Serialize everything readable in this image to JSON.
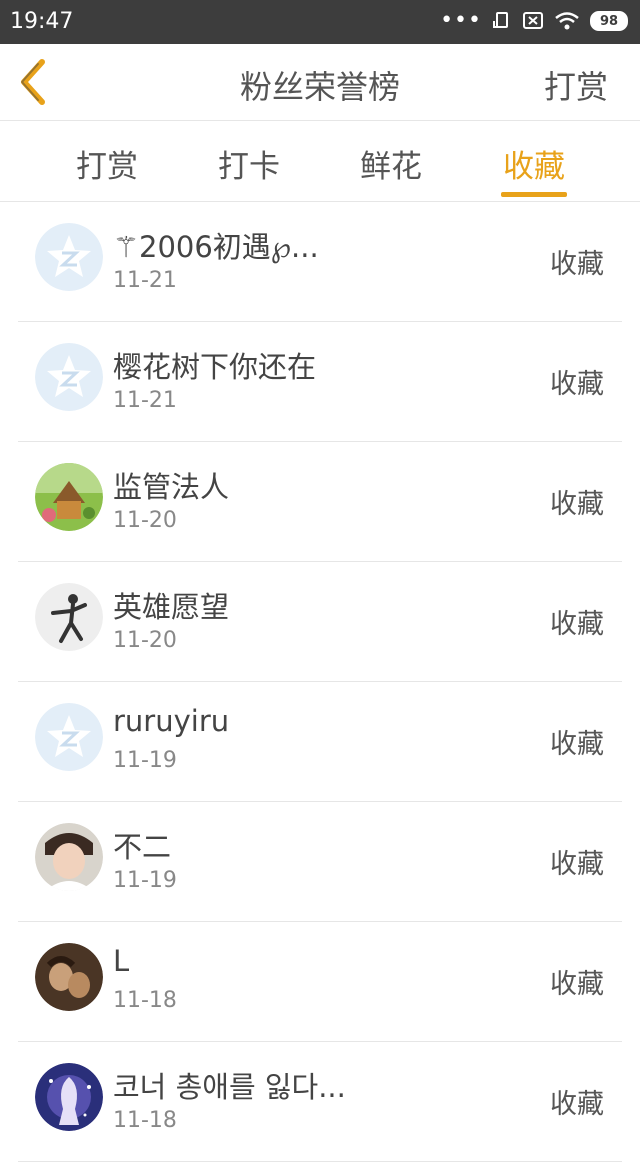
{
  "status_bar": {
    "time": "19:47",
    "battery": "98",
    "dots": "•••"
  },
  "header": {
    "title": "粉丝荣誉榜",
    "action": "打赏"
  },
  "tabs": [
    {
      "label": "打赏"
    },
    {
      "label": "打卡"
    },
    {
      "label": "鲜花"
    },
    {
      "label": "收藏"
    }
  ],
  "active_tab": "收藏",
  "colors": {
    "accent": "#e8a21a",
    "status_bar": "#3d3d3d",
    "text": "#555555",
    "divider": "#e6e6e6"
  },
  "list": [
    {
      "name": "⚚2006初遇℘...",
      "date": "11-21",
      "action": "收藏",
      "avatar": "default-qq-avatar"
    },
    {
      "name": "樱花树下你还在",
      "date": "11-21",
      "action": "收藏",
      "avatar": "default-qq-avatar"
    },
    {
      "name": "监管法人",
      "date": "11-20",
      "action": "收藏",
      "avatar": "photo-avatar"
    },
    {
      "name": "英雄愿望",
      "date": "11-20",
      "action": "收藏",
      "avatar": "photo-avatar"
    },
    {
      "name": "ruruyiru",
      "date": "11-19",
      "action": "收藏",
      "avatar": "default-qq-avatar"
    },
    {
      "name": "不二",
      "date": "11-19",
      "action": "收藏",
      "avatar": "photo-avatar"
    },
    {
      "name": "L",
      "date": "11-18",
      "action": "收藏",
      "avatar": "photo-avatar"
    },
    {
      "name": "코너 총애를 잃다...",
      "date": "11-18",
      "action": "收藏",
      "avatar": "photo-avatar"
    }
  ]
}
